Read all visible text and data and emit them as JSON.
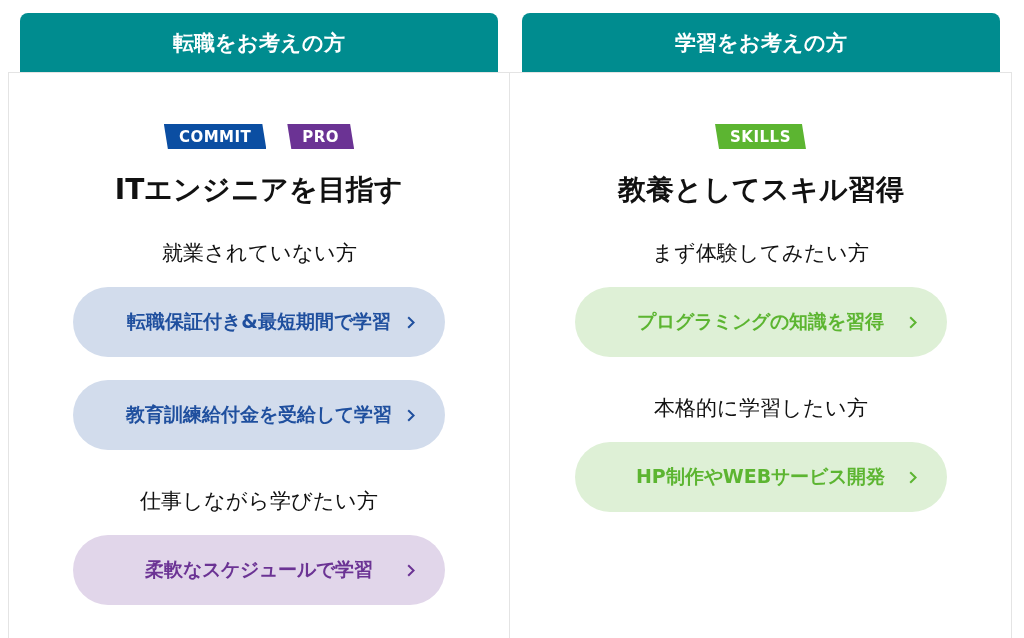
{
  "columns": [
    {
      "header": "転職をお考えの方",
      "badges": [
        {
          "label": "COMMIT",
          "color": "#0b4ea2"
        },
        {
          "label": "PRO",
          "color": "#6b3394"
        }
      ],
      "title": "ITエンジニアを目指す",
      "groups": [
        {
          "heading": "就業されていない方",
          "links": [
            {
              "label": "転職保証付き&最短期間で学習",
              "color": "#1f4f9e"
            },
            {
              "label": "教育訓練給付金を受給して学習",
              "color": "#1f4f9e"
            }
          ]
        },
        {
          "heading": "仕事しながら学びたい方",
          "links": [
            {
              "label": "柔軟なスケジュールで学習",
              "color": "#6b3394"
            }
          ]
        }
      ]
    },
    {
      "header": "学習をお考えの方",
      "badges": [
        {
          "label": "SKILLS",
          "color": "#5cb531"
        }
      ],
      "title": "教養としてスキル習得",
      "groups": [
        {
          "heading": "まず体験してみたい方",
          "links": [
            {
              "label": "プログラミングの知識を習得",
              "color": "#5cb531"
            }
          ]
        },
        {
          "heading": "本格的に学習したい方",
          "links": [
            {
              "label": "HP制作やWEBサービス開発",
              "color": "#5cb531"
            }
          ]
        }
      ]
    }
  ]
}
